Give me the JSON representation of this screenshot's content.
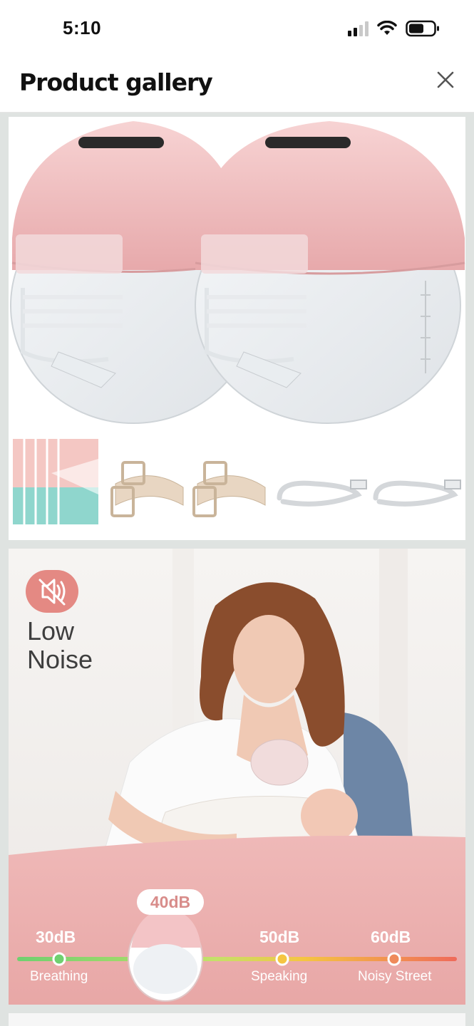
{
  "status_bar": {
    "time": "5:10"
  },
  "header": {
    "title": "Product gallery"
  },
  "gallery": {
    "images": [
      {
        "kind": "product-photo"
      },
      {
        "kind": "lifestyle-photo",
        "badge_line1": "Low",
        "badge_line2": "Noise",
        "current_level": "40dB",
        "scale": [
          {
            "value": "30dB",
            "label": "Breathing"
          },
          {
            "value": "50dB",
            "label": "Speaking"
          },
          {
            "value": "60dB",
            "label": "Noisy Street"
          }
        ]
      },
      {
        "kind": "next-photo"
      }
    ]
  },
  "colors": {
    "pink": "#efbcbd",
    "pink_dark": "#d88c8a",
    "green": "#6fd06f",
    "yellow": "#f5c542",
    "red": "#ef6a5a"
  }
}
